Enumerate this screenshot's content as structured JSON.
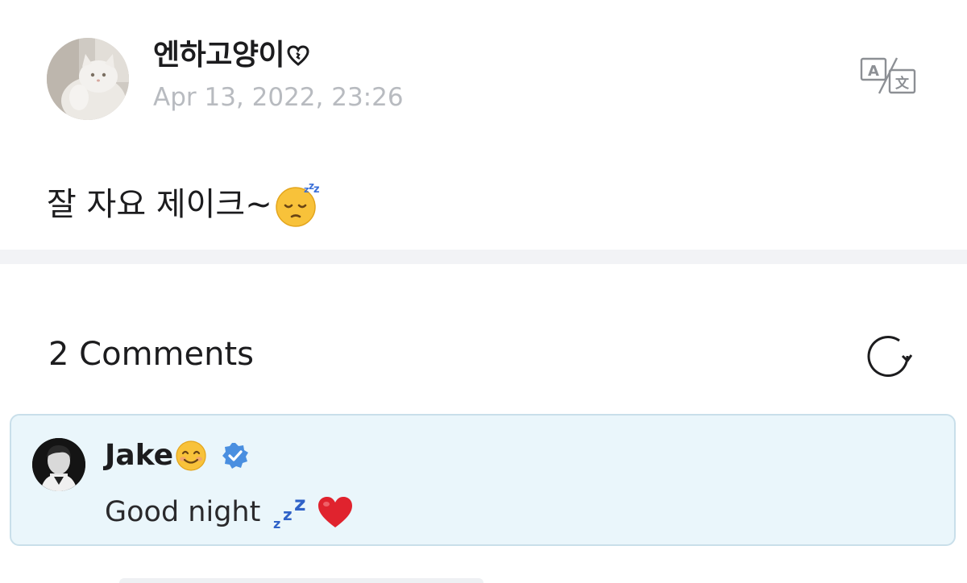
{
  "post": {
    "author": "엔하고양이",
    "date": "Apr 13, 2022, 23:26",
    "text": "잘 자요 제이크~"
  },
  "comments": {
    "title": "2 Comments",
    "items": [
      {
        "author": "Jake",
        "text": "Good night",
        "verified": true
      }
    ]
  },
  "icons": {
    "translate": "translate-icon",
    "refresh": "refresh-icon",
    "verified": "verified-badge-icon",
    "author_heart": "heart-outline-icon",
    "post_emoji": "sleeping-face-emoji",
    "comment_author_emoji": "smiling-face-emoji",
    "comment_zzz": "zzz-emoji",
    "comment_heart": "red-heart-emoji"
  },
  "colors": {
    "date_gray": "#b8bbc0",
    "comment_bg": "#eaf6fb",
    "comment_border": "#c9dfea",
    "verified_blue": "#4a8fe0",
    "divider": "#f2f3f6"
  }
}
